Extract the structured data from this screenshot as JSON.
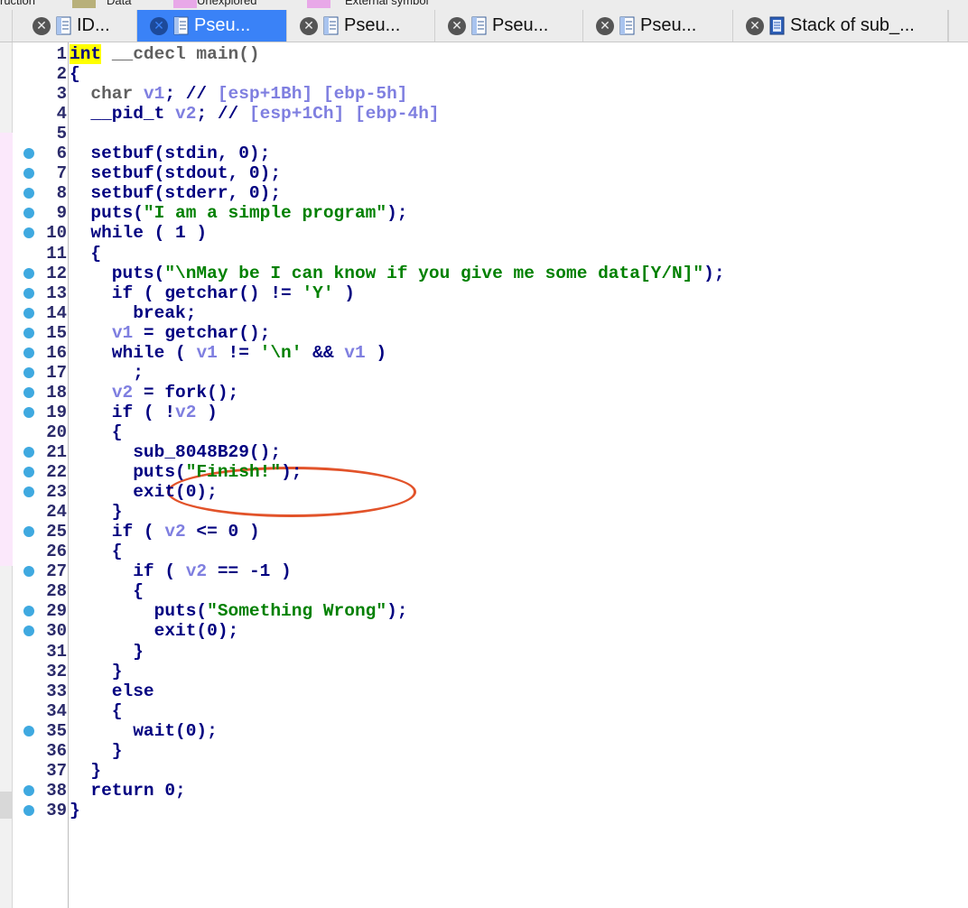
{
  "legend": {
    "items": [
      {
        "label": "ruction",
        "color": "#888888"
      },
      {
        "label": "Data",
        "color": "#b8b07a"
      },
      {
        "label": "Unexplored",
        "color": "#e8a8e8"
      },
      {
        "label": "External symbol",
        "color": "#e8a8e8"
      }
    ]
  },
  "tabs": [
    {
      "label": "ID...",
      "active": false,
      "icon": "view-icon"
    },
    {
      "label": "Pseu...",
      "active": true,
      "icon": "pseudocode-icon"
    },
    {
      "label": "Pseu...",
      "active": false,
      "icon": "pseudocode-icon"
    },
    {
      "label": "Pseu...",
      "active": false,
      "icon": "pseudocode-icon"
    },
    {
      "label": "Pseu...",
      "active": false,
      "icon": "pseudocode-icon"
    },
    {
      "label": "Stack of sub_...",
      "active": false,
      "icon": "stack-icon"
    }
  ],
  "code": {
    "lines": [
      {
        "n": "1",
        "dot": false,
        "text": "int __cdecl main()"
      },
      {
        "n": "2",
        "dot": false,
        "text": "{"
      },
      {
        "n": "3",
        "dot": false,
        "text": "  char v1; // [esp+1Bh] [ebp-5h]"
      },
      {
        "n": "4",
        "dot": false,
        "text": "  __pid_t v2; // [esp+1Ch] [ebp-4h]"
      },
      {
        "n": "5",
        "dot": false,
        "text": ""
      },
      {
        "n": "6",
        "dot": true,
        "text": "  setbuf(stdin, 0);"
      },
      {
        "n": "7",
        "dot": true,
        "text": "  setbuf(stdout, 0);"
      },
      {
        "n": "8",
        "dot": true,
        "text": "  setbuf(stderr, 0);"
      },
      {
        "n": "9",
        "dot": true,
        "text": "  puts(\"I am a simple program\");"
      },
      {
        "n": "10",
        "dot": true,
        "text": "  while ( 1 )"
      },
      {
        "n": "11",
        "dot": false,
        "text": "  {"
      },
      {
        "n": "12",
        "dot": true,
        "text": "    puts(\"\\nMay be I can know if you give me some data[Y/N]\");"
      },
      {
        "n": "13",
        "dot": true,
        "text": "    if ( getchar() != 'Y' )"
      },
      {
        "n": "14",
        "dot": true,
        "text": "      break;"
      },
      {
        "n": "15",
        "dot": true,
        "text": "    v1 = getchar();"
      },
      {
        "n": "16",
        "dot": true,
        "text": "    while ( v1 != '\\n' && v1 )"
      },
      {
        "n": "17",
        "dot": true,
        "text": "      ;"
      },
      {
        "n": "18",
        "dot": true,
        "text": "    v2 = fork();"
      },
      {
        "n": "19",
        "dot": true,
        "text": "    if ( !v2 )"
      },
      {
        "n": "20",
        "dot": false,
        "text": "    {"
      },
      {
        "n": "21",
        "dot": true,
        "text": "      sub_8048B29();"
      },
      {
        "n": "22",
        "dot": true,
        "text": "      puts(\"Finish!\");"
      },
      {
        "n": "23",
        "dot": true,
        "text": "      exit(0);"
      },
      {
        "n": "24",
        "dot": false,
        "text": "    }"
      },
      {
        "n": "25",
        "dot": true,
        "text": "    if ( v2 <= 0 )"
      },
      {
        "n": "26",
        "dot": false,
        "text": "    {"
      },
      {
        "n": "27",
        "dot": true,
        "text": "      if ( v2 == -1 )"
      },
      {
        "n": "28",
        "dot": false,
        "text": "      {"
      },
      {
        "n": "29",
        "dot": true,
        "text": "        puts(\"Something Wrong\");"
      },
      {
        "n": "30",
        "dot": true,
        "text": "        exit(0);"
      },
      {
        "n": "31",
        "dot": false,
        "text": "      }"
      },
      {
        "n": "32",
        "dot": false,
        "text": "    }"
      },
      {
        "n": "33",
        "dot": false,
        "text": "    else"
      },
      {
        "n": "34",
        "dot": false,
        "text": "    {"
      },
      {
        "n": "35",
        "dot": true,
        "text": "      wait(0);"
      },
      {
        "n": "36",
        "dot": false,
        "text": "    }"
      },
      {
        "n": "37",
        "dot": false,
        "text": "  }"
      },
      {
        "n": "38",
        "dot": true,
        "text": "  return 0;"
      },
      {
        "n": "39",
        "dot": true,
        "text": "}"
      }
    ],
    "highlight_token": "int",
    "variables": [
      "v1",
      "v2"
    ],
    "circled_line": "21"
  },
  "colors": {
    "active_tab": "#3a82f7",
    "keyword": "#000080",
    "variable": "#7f7fe0",
    "string": "#008000",
    "highlight": "#ffff00",
    "annotation_oval": "#e2532a",
    "line_dot": "#3fa9e0"
  }
}
